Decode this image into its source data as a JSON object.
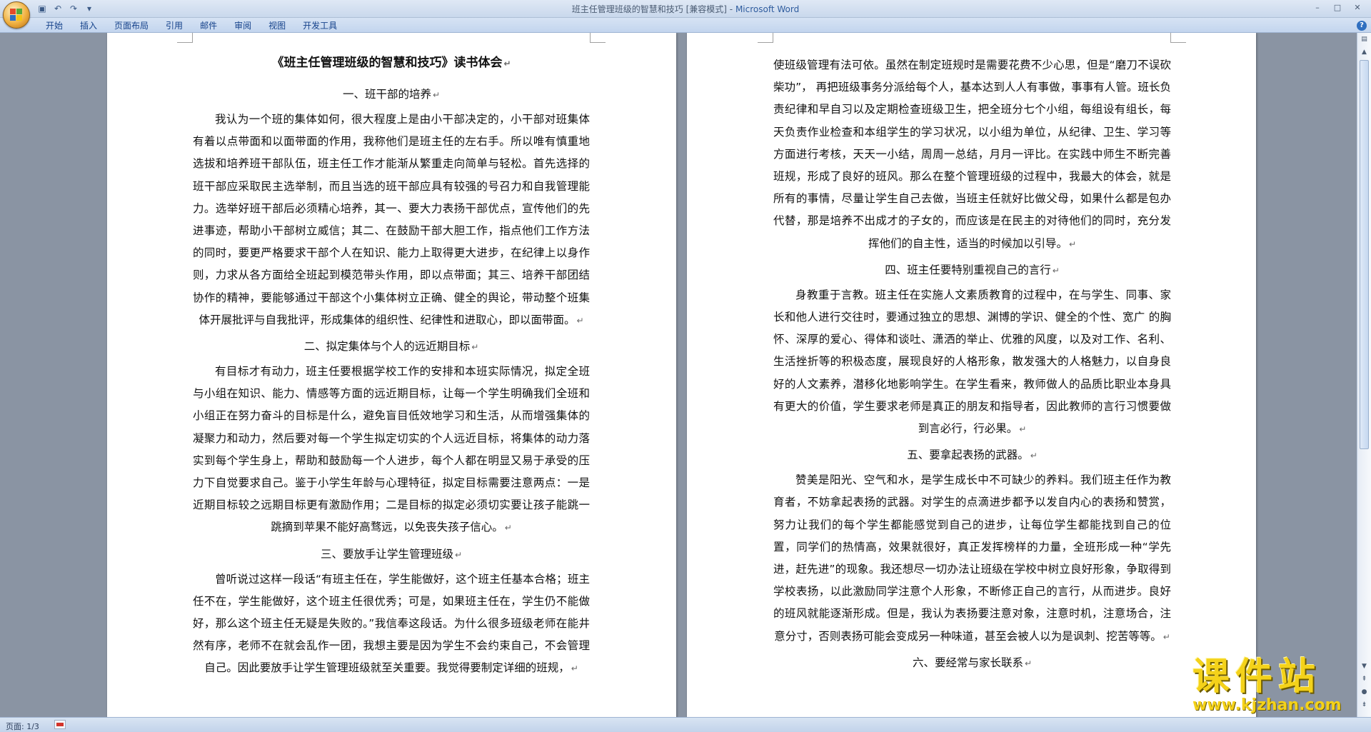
{
  "window": {
    "title": "班主任管理班级的智慧和技巧 [兼容模式]",
    "separator": " - ",
    "app_name": "Microsoft Word",
    "controls": [
      "–",
      "□",
      "✕"
    ]
  },
  "quick_access": [
    "save-icon",
    "undo-icon",
    "redo-icon",
    "customize-icon"
  ],
  "ribbon": {
    "tabs": [
      "开始",
      "插入",
      "页面布局",
      "引用",
      "邮件",
      "审阅",
      "视图",
      "开发工具"
    ]
  },
  "pages": [
    {
      "title": "《班主任管理班级的智慧和技巧》读书体会",
      "blocks": [
        {
          "type": "heading",
          "text": "一、班干部的培养"
        },
        {
          "type": "para",
          "text": "我认为一个班的集体如何，很大程度上是由小干部决定的，小干部对班集体有着以点带面和以面带面的作用，我称他们是班主任的左右手。所以唯有慎重地选拔和培养班干部队伍，班主任工作才能渐从繁重走向简单与轻松。首先选择的班干部应采取民主选举制，而且当选的班干部应具有较强的号召力和自我管理能力。选举好班干部后必须精心培养，其一、要大力表扬干部优点，宣传他们的先进事迹，帮助小干部树立威信；其二、在鼓励干部大胆工作，指点他们工作方法的同时，要更严格要求干部个人在知识、能力上取得更大进步，在纪律上以身作则，力求从各方面给全班起到模范带头作用，即以点带面；其三、培养干部团结协作的精神，要能够通过干部这个小集体树立正确、健全的舆论，带动整个班集体开展批评与自我批评，形成集体的组织性、纪律性和进取心，即以面带面。"
        },
        {
          "type": "heading",
          "text": "二、拟定集体与个人的远近期目标"
        },
        {
          "type": "para",
          "text": "有目标才有动力，班主任要根据学校工作的安排和本班实际情况，拟定全班与小组在知识、能力、情感等方面的远近期目标，让每一个学生明确我们全班和小组正在努力奋斗的目标是什么，避免盲目低效地学习和生活，从而增强集体的凝聚力和动力，然后要对每一个学生拟定切实的个人远近目标，将集体的动力落实到每个学生身上，帮助和鼓励每一个人进步，每个人都在明显又易于承受的压力下自觉要求自己。鉴于小学生年龄与心理特征，拟定目标需要注意两点：一是近期目标较之远期目标更有激励作用；二是目标的拟定必须切实要让孩子能跳一跳摘到苹果不能好高骛远，以免丧失孩子信心。"
        },
        {
          "type": "heading",
          "text": "三、要放手让学生管理班级"
        },
        {
          "type": "para",
          "text": "曾听说过这样一段话“有班主任在，学生能做好，这个班主任基本合格；班主任不在，学生能做好，这个班主任很优秀；可是，如果班主任在，学生仍不能做好，那么这个班主任无疑是失败的。”我信奉这段话。为什么很多班级老师在能井然有序，老师不在就会乱作一团，我想主要是因为学生不会约束自己，不会管理自己。因此要放手让学生管理班级就至关重要。我觉得要制定详细的班规，"
        }
      ]
    },
    {
      "blocks": [
        {
          "type": "para",
          "first": true,
          "text": "使班级管理有法可依。虽然在制定班规时是需要花费不少心思，但是“磨刀不误砍柴功”， 再把班级事务分派给每个人，基本达到人人有事做，事事有人管。班长负责纪律和早自习以及定期检查班级卫生，把全班分七个小组，每组设有组长，每天负责作业检查和本组学生的学习状况，以小组为单位，从纪律、卫生、学习等方面进行考核，天天一小结，周周一总结，月月一评比。在实践中师生不断完善班规，形成了良好的班风。那么在整个管理班级的过程中，我最大的体会，就是所有的事情，尽量让学生自己去做，当班主任就好比做父母，如果什么都是包办代替，那是培养不出成才的子女的，而应该是在民主的对待他们的同时，充分发挥他们的自主性，适当的时候加以引导。"
        },
        {
          "type": "heading",
          "text": "四、班主任要特别重视自己的言行"
        },
        {
          "type": "para",
          "text": "身教重于言教。班主任在实施人文素质教育的过程中，在与学生、同事、家长和他人进行交往时，要通过独立的思想、渊博的学识、健全的个性、宽广 的胸怀、深厚的爱心、得体和谈吐、潇洒的举止、优雅的风度，以及对工作、名利、生活挫折等的积极态度，展现良好的人格形象，散发强大的人格魅力，以自身良好的人文素养，潜移化地影响学生。在学生看来，教师做人的品质比职业本身具有更大的价值，学生要求老师是真正的朋友和指导者，因此教师的言行习惯要做到言必行，行必果。"
        },
        {
          "type": "heading",
          "text": "五、要拿起表扬的武器。"
        },
        {
          "type": "para",
          "text": "赞美是阳光、空气和水，是学生成长中不可缺少的养料。我们班主任作为教育者，不妨拿起表扬的武器。对学生的点滴进步都予以发自内心的表扬和赞赏，努力让我们的每个学生都能感觉到自己的进步，让每位学生都能找到自己的位置，同学们的热情高，效果就很好，真正发挥榜样的力量，全班形成一种“学先进，赶先进”的现象。我还想尽一切办法让班级在学校中树立良好形象，争取得到学校表扬，以此激励同学注意个人形象，不断修正自己的言行，从而进步。良好的班风就能逐渐形成。但是，我认为表扬要注意对象，注意时机，注意场合，注意分寸，否则表扬可能会变成另一种味道，甚至会被人以为是讽刺、挖苦等等。"
        },
        {
          "type": "heading",
          "text": "六、要经常与家长联系"
        }
      ]
    }
  ],
  "paragraph_mark": "↵",
  "status_bar": {
    "page_info": "页面: 1/3"
  },
  "watermark": {
    "main": "课件站",
    "url": "www.kjzhan.com"
  }
}
